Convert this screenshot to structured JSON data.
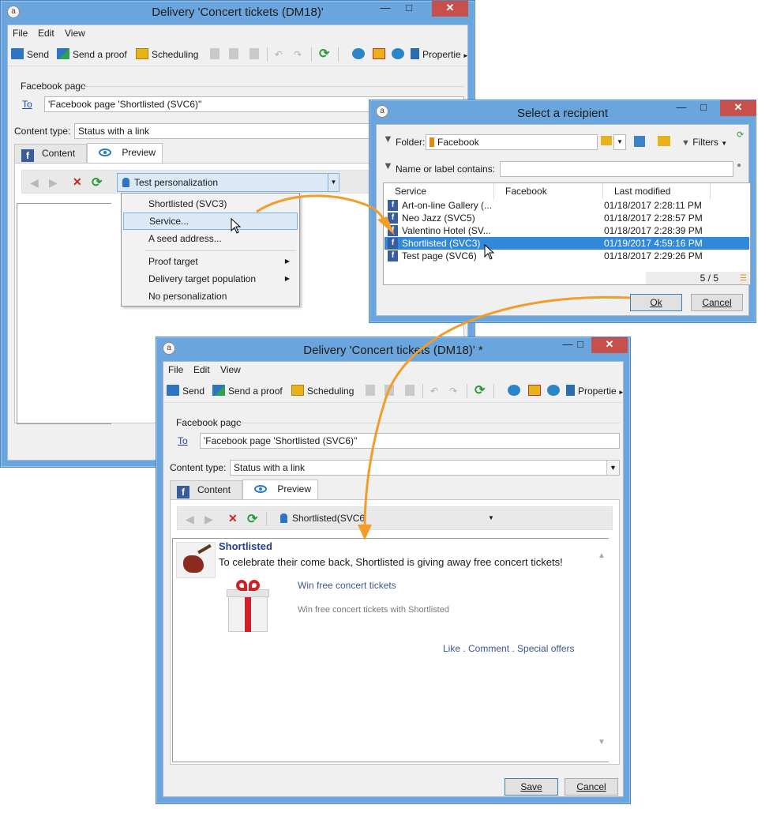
{
  "colors": {
    "accent": "#3389d9",
    "window_frame": "#6aa6dd",
    "close_button": "#c7504b",
    "link": "#2145b7",
    "arrow": "#f29d2a"
  },
  "window1": {
    "title": "Delivery 'Concert tickets (DM18)'",
    "menu": {
      "file": "File",
      "edit": "Edit",
      "view": "View"
    },
    "toolbar": {
      "send": "Send",
      "send_proof": "Send a proof",
      "scheduling": "Scheduling",
      "properties": "Propertie"
    },
    "section_label": "Facebook page",
    "to_label": "To",
    "to_value": "'Facebook page 'Shortlisted (SVC6)''",
    "content_type_label": "Content type:",
    "content_type_value": "Status with a link",
    "tabs": {
      "content": "Content",
      "preview": "Preview"
    },
    "personalization_label": "Test personalization",
    "dropdown": {
      "items": [
        {
          "label": "Shortlisted (SVC3)"
        },
        {
          "label": "Service..."
        },
        {
          "label": "A seed address..."
        },
        {
          "label": "Proof target"
        },
        {
          "label": "Delivery target population"
        },
        {
          "label": "No personalization"
        }
      ]
    }
  },
  "dialog": {
    "title": "Select a recipient",
    "folder_label": "Folder:",
    "folder_value": "Facebook",
    "filters_label": "Filters",
    "name_filter_label": "Name or label contains:",
    "name_filter_value": "",
    "columns": {
      "service": "Service",
      "facebook": "Facebook",
      "last_modified": "Last modified"
    },
    "rows": [
      {
        "service": "Art-on-line Gallery (...",
        "last_modified": "01/18/2017 2:28:11 PM",
        "selected": false
      },
      {
        "service": "Neo Jazz (SVC5)",
        "last_modified": "01/18/2017 2:28:57 PM",
        "selected": false
      },
      {
        "service": "Valentino Hotel (SV...",
        "last_modified": "01/18/2017 2:28:39 PM",
        "selected": false
      },
      {
        "service": "Shortlisted (SVC3)",
        "last_modified": "01/19/2017 4:59:16 PM",
        "selected": true
      },
      {
        "service": "Test page (SVC6)",
        "last_modified": "01/18/2017 2:29:26 PM",
        "selected": false
      }
    ],
    "count": "5 / 5",
    "ok": "Ok",
    "cancel": "Cancel"
  },
  "window2": {
    "title": "Delivery 'Concert tickets (DM18)' *",
    "menu": {
      "file": "File",
      "edit": "Edit",
      "view": "View"
    },
    "toolbar": {
      "send": "Send",
      "send_proof": "Send a proof",
      "scheduling": "Scheduling",
      "properties": "Propertie"
    },
    "section_label": "Facebook page",
    "to_label": "To",
    "to_value": "'Facebook page 'Shortlisted (SVC6)''",
    "content_type_label": "Content type:",
    "content_type_value": "Status with a link",
    "tabs": {
      "content": "Content",
      "preview": "Preview"
    },
    "personalization_value": "Shortlisted(SVC6",
    "post": {
      "author": "Shortlisted",
      "message": "To celebrate their come back, Shortlisted is giving away free concert tickets!",
      "link_title": "Win free concert tickets",
      "link_description": "Win free concert tickets with Shortlisted",
      "actions": "Like . Comment . Special offers"
    },
    "save": "Save",
    "cancel": "Cancel"
  }
}
